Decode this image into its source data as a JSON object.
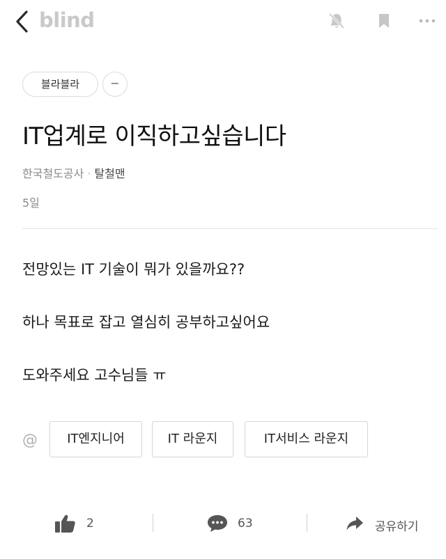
{
  "app": {
    "brand": "blind"
  },
  "board_chip": {
    "label": "블라블라",
    "toggle_label": "−"
  },
  "post": {
    "title": "IT업계로 이직하고싶습니다",
    "company": "한국철도공사",
    "separator": "·",
    "author": "탈철맨",
    "time": "5일",
    "body": [
      "전망있는 IT 기술이 뭐가 있을까요??",
      "하나 목표로 잡고 열심히 공부하고싶어요",
      "도와주세요 고수님들 ㅠ"
    ]
  },
  "tags": {
    "at_symbol": "@",
    "items": [
      "IT엔지니어",
      "IT 라운지",
      "IT서비스 라운지"
    ]
  },
  "actions": {
    "like_count": "2",
    "comment_count": "63",
    "share_label": "공유하기"
  },
  "icons": [
    "back-chevron-icon",
    "notification-off-icon",
    "bookmark-icon",
    "more-icon",
    "thumbs-up-icon",
    "comment-icon",
    "share-arrow-icon"
  ],
  "colors": {
    "icon_gray": "#c7c7c7",
    "action_gray": "#555555",
    "divider": "#e4e4e4"
  }
}
